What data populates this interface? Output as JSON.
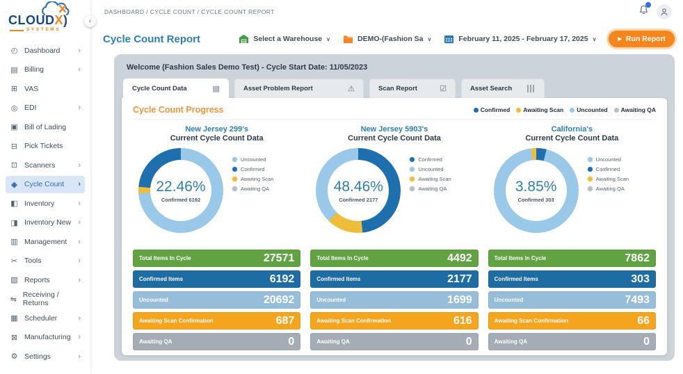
{
  "brand": {
    "name": "CLOUD",
    "x": "X",
    "paren": ")",
    "sub": "SYSTEMS"
  },
  "topbar": {
    "breadcrumb": "DASHBOARD / CYCLE COUNT / CYCLE COUNT REPORT"
  },
  "collapse": "‹",
  "sidebar": {
    "items": [
      {
        "label": "Dashboard",
        "glyph": "◴",
        "chevron": "›"
      },
      {
        "label": "Billing",
        "glyph": "▤",
        "chevron": "›"
      },
      {
        "label": "VAS",
        "glyph": "⊞",
        "chevron": ""
      },
      {
        "label": "EDI",
        "glyph": "◎",
        "chevron": "›"
      },
      {
        "label": "Bill of Lading",
        "glyph": "▣",
        "chevron": ""
      },
      {
        "label": "Pick Tickets",
        "glyph": "⊟",
        "chevron": ""
      },
      {
        "label": "Scanners",
        "glyph": "⊡",
        "chevron": "›"
      },
      {
        "label": "Cycle Count",
        "glyph": "◈",
        "chevron": "›"
      },
      {
        "label": "Inventory",
        "glyph": "◧",
        "chevron": "›"
      },
      {
        "label": "Inventory New",
        "glyph": "◨",
        "chevron": "›"
      },
      {
        "label": "Management",
        "glyph": "▥",
        "chevron": "›"
      },
      {
        "label": "Tools",
        "glyph": "✂",
        "chevron": "›"
      },
      {
        "label": "Reports",
        "glyph": "▧",
        "chevron": "›"
      },
      {
        "label": "Receiving / Returns",
        "glyph": "⇋",
        "chevron": ""
      },
      {
        "label": "Scheduler",
        "glyph": "▦",
        "chevron": "›"
      },
      {
        "label": "Manufacturing",
        "glyph": "⊠",
        "chevron": "›"
      },
      {
        "label": "Settings",
        "glyph": "⚙",
        "chevron": "›"
      }
    ]
  },
  "header": {
    "title": "Cycle Count Report",
    "warehouse_select": "Select a Warehouse",
    "client_select": "DEMO-(Fashion Sa",
    "date_range": "February 11, 2025 - February 17, 2025",
    "run_report": "Run Report",
    "chevron": "∨",
    "play": "▶"
  },
  "welcome": "Welcome (Fashion Sales Demo Test) - Cycle Start Date: 11/05/2023",
  "tabs": [
    {
      "label": "Cycle Count Data",
      "icon": "database",
      "glyph": "▤",
      "active": true
    },
    {
      "label": "Asset Problem Report",
      "icon": "warning",
      "glyph": "⚠",
      "active": false
    },
    {
      "label": "Scan Report",
      "icon": "checkbox",
      "glyph": "☑",
      "active": false
    },
    {
      "label": "Asset Search",
      "icon": "barcode",
      "glyph": "",
      "active": false
    }
  ],
  "progress": {
    "title": "Cycle Count Progress",
    "legend": [
      {
        "label": "Confirmed",
        "color": "#1e6fae"
      },
      {
        "label": "Awaiting Scan",
        "color": "#eebd3a"
      },
      {
        "label": "Uncounted",
        "color": "#9ac8e8"
      },
      {
        "label": "Awaiting QA",
        "color": "#b6bec6"
      }
    ]
  },
  "warehouses": [
    {
      "name": "New Jersey 299's",
      "subtitle": "Current Cycle Count Data",
      "percent": "22.46%",
      "confirmed_label": "Confirmed 6192",
      "legend": [
        {
          "label": "Uncounted",
          "color": "#9ac8e8"
        },
        {
          "label": "Confirmed",
          "color": "#1e6fae"
        },
        {
          "label": "Awaiting Scan",
          "color": "#eebd3a"
        },
        {
          "label": "Awaiting QA",
          "color": "#b6bec6"
        }
      ],
      "donut": {
        "segments": [
          {
            "name": "Uncounted",
            "color": "#9ac8e8",
            "from": 0,
            "to": 266
          },
          {
            "name": "Awaiting Scan",
            "color": "#eebd3a",
            "from": 266,
            "to": 275
          },
          {
            "name": "Confirmed",
            "color": "#1e6fae",
            "from": 275,
            "to": 360
          }
        ]
      },
      "table": [
        {
          "label": "Total Items In Cycle",
          "value": "27571",
          "color": "#61a343"
        },
        {
          "label": "Confirmed Items",
          "value": "6192",
          "color": "#1d6ca3"
        },
        {
          "label": "Uncounted",
          "value": "20692",
          "color": "#96bedb"
        },
        {
          "label": "Awaiting Scan Confirmation",
          "value": "687",
          "color": "#f5a41d"
        },
        {
          "label": "Awaiting QA",
          "value": "0",
          "color": "#a4adb5"
        }
      ]
    },
    {
      "name": "New Jersey 5903's",
      "subtitle": "Current Cycle Count Data",
      "percent": "48.46%",
      "confirmed_label": "Confirmed 2177",
      "legend": [
        {
          "label": "Confirmed",
          "color": "#1e6fae"
        },
        {
          "label": "Uncounted",
          "color": "#9ac8e8"
        },
        {
          "label": "Awaiting Scan",
          "color": "#eebd3a"
        },
        {
          "label": "Awaiting QA",
          "color": "#b6bec6"
        }
      ],
      "donut": {
        "segments": [
          {
            "name": "Confirmed",
            "color": "#1e6fae",
            "from": 0,
            "to": 174
          },
          {
            "name": "Awaiting Scan",
            "color": "#eebd3a",
            "from": 174,
            "to": 224
          },
          {
            "name": "Uncounted",
            "color": "#9ac8e8",
            "from": 224,
            "to": 360
          }
        ]
      },
      "table": [
        {
          "label": "Total Items In Cycle",
          "value": "4492",
          "color": "#61a343"
        },
        {
          "label": "Confirmed Items",
          "value": "2177",
          "color": "#1d6ca3"
        },
        {
          "label": "Uncounted",
          "value": "1699",
          "color": "#96bedb"
        },
        {
          "label": "Awaiting Scan Confirmation",
          "value": "616",
          "color": "#f5a41d"
        },
        {
          "label": "Awaiting QA",
          "value": "0",
          "color": "#a4adb5"
        }
      ]
    },
    {
      "name": "California's",
      "subtitle": "Current Cycle Count Data",
      "percent": "3.85%",
      "confirmed_label": "Confirmed 303",
      "legend": [
        {
          "label": "Uncounted",
          "color": "#9ac8e8"
        },
        {
          "label": "Confirmed",
          "color": "#1e6fae"
        },
        {
          "label": "Awaiting Scan",
          "color": "#eebd3a"
        },
        {
          "label": "Awaiting QA",
          "color": "#b6bec6"
        }
      ],
      "donut": {
        "segments": [
          {
            "name": "Confirmed",
            "color": "#1e6fae",
            "from": 0,
            "to": 14
          },
          {
            "name": "Uncounted",
            "color": "#9ac8e8",
            "from": 14,
            "to": 353
          },
          {
            "name": "Awaiting Scan",
            "color": "#eebd3a",
            "from": 353,
            "to": 360
          }
        ]
      },
      "table": [
        {
          "label": "Total Items In Cycle",
          "value": "7862",
          "color": "#61a343"
        },
        {
          "label": "Confirmed Items",
          "value": "303",
          "color": "#1d6ca3"
        },
        {
          "label": "Uncounted",
          "value": "7493",
          "color": "#96bedb"
        },
        {
          "label": "Awaiting Scan Confirmation",
          "value": "66",
          "color": "#f5a41d"
        },
        {
          "label": "Awaiting QA",
          "value": "0",
          "color": "#a4adb5"
        }
      ]
    }
  ],
  "chart_data": [
    {
      "type": "pie",
      "title": "New Jersey 299's Current Cycle Count Data",
      "categories": [
        "Confirmed",
        "Uncounted",
        "Awaiting Scan",
        "Awaiting QA"
      ],
      "values": [
        6192,
        20692,
        687,
        0
      ],
      "total": 27571,
      "center_label": "22.46%",
      "center_sublabel": "Confirmed 6192",
      "legend_position": "right"
    },
    {
      "type": "pie",
      "title": "New Jersey 5903's Current Cycle Count Data",
      "categories": [
        "Confirmed",
        "Uncounted",
        "Awaiting Scan",
        "Awaiting QA"
      ],
      "values": [
        2177,
        1699,
        616,
        0
      ],
      "total": 4492,
      "center_label": "48.46%",
      "center_sublabel": "Confirmed 2177",
      "legend_position": "right"
    },
    {
      "type": "pie",
      "title": "California's Current Cycle Count Data",
      "categories": [
        "Confirmed",
        "Uncounted",
        "Awaiting Scan",
        "Awaiting QA"
      ],
      "values": [
        303,
        7493,
        66,
        0
      ],
      "total": 7862,
      "center_label": "3.85%",
      "center_sublabel": "Confirmed 303",
      "legend_position": "right"
    }
  ],
  "colors": {
    "accent_orange": "#f5861e",
    "title_blue": "#2e7fb1",
    "heading_orange": "#f0953a",
    "panel_gray": "#ccd3da",
    "active_nav_bg": "#d9e6f7",
    "row_green": "#61a343",
    "row_blue": "#1d6ca3",
    "row_lightblue": "#96bedb",
    "row_orange": "#f5a41d",
    "row_gray": "#a4adb5",
    "donut_confirmed": "#1e6fae",
    "donut_uncounted": "#9ac8e8",
    "donut_awaiting_scan": "#eebd3a",
    "donut_awaiting_qa": "#b6bec6"
  }
}
